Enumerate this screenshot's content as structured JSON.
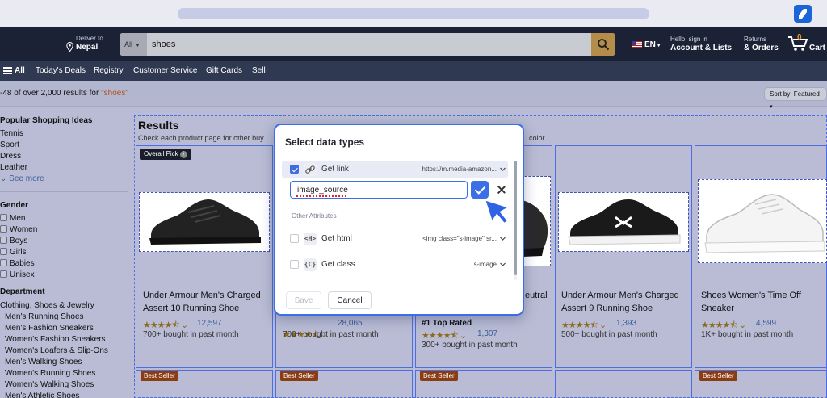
{
  "header": {
    "deliver_line1": "Deliver to",
    "deliver_line2": "Nepal",
    "search_category": "All",
    "search_value": "shoes",
    "language": "EN",
    "account_line1": "Hello, sign in",
    "account_line2": "Account & Lists",
    "orders_line1": "Returns",
    "orders_line2": "& Orders",
    "cart_count": "0",
    "cart_label": "Cart"
  },
  "nav": {
    "all": "All",
    "items": [
      "Today's Deals",
      "Registry",
      "Customer Service",
      "Gift Cards",
      "Sell"
    ]
  },
  "results_bar": {
    "prefix": "-48 of over 2,000 results for ",
    "query": "\"shoes\"",
    "sort_label": "Sort by: Featured"
  },
  "sidebar": {
    "popular_heading": "Popular Shopping Ideas",
    "popular": [
      "Tennis",
      "Sport",
      "Dress",
      "Leather"
    ],
    "see_more": "See more",
    "gender_heading": "Gender",
    "gender": [
      "Men",
      "Women",
      "Boys",
      "Girls",
      "Babies",
      "Unisex"
    ],
    "department_heading": "Department",
    "department_top": "Clothing, Shoes & Jewelry",
    "department": [
      "Men's Running Shoes",
      "Men's Fashion Sneakers",
      "Women's Fashion Sneakers",
      "Women's Loafers & Slip-Ons",
      "Men's Walking Shoes",
      "Women's Running Shoes",
      "Women's Walking Shoes",
      "Men's Athletic Shoes"
    ]
  },
  "results": {
    "title": "Results",
    "desc_left": "Check each product page for other buy",
    "desc_right": "color.",
    "overall_pick": "Overall Pick",
    "cards": [
      {
        "name1": "Under Armour Men's Charged",
        "name2": "Assert 10 Running Shoe",
        "rating": "12,597",
        "bought": "700+ bought in past month"
      },
      {
        "rating": "28,065",
        "bought": "700+ bought in past month"
      },
      {
        "name1": "eutral",
        "top_rated": "#1 Top Rated",
        "rating": "1,307",
        "bought": "300+ bought in past month"
      },
      {
        "name1": "Under Armour Men's Charged",
        "name2": "Assert 9 Running Shoe",
        "rating": "1,393",
        "bought": "500+ bought in past month"
      },
      {
        "name1": "Shoes Women's Time Off",
        "name2": "Sneaker",
        "rating": "4,599",
        "bought": "1K+ bought in past month"
      }
    ],
    "best_seller": "Best Seller"
  },
  "modal": {
    "title": "Select data types",
    "get_link_label": "Get link",
    "get_link_value": "https://m.media-amazon...",
    "name_input": "image_source",
    "other_attributes": "Other Attributes",
    "get_html_label": "Get html",
    "get_html_value": "<img class=\"s-image\" sr...",
    "get_class_label": "Get class",
    "get_class_value": "s-image",
    "save": "Save",
    "cancel": "Cancel",
    "icons": {
      "link": "link-icon",
      "html": "html-tag-icon",
      "class": "class-brace-icon"
    }
  },
  "colors": {
    "accent": "#3b6fe8",
    "overlay": "#b9bcd4",
    "star": "#8a6a1a",
    "best_seller": "#8a3c12"
  }
}
